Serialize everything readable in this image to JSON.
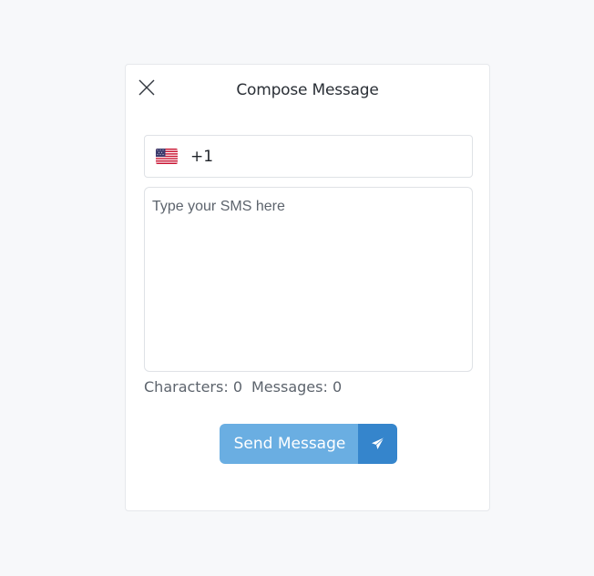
{
  "dialog": {
    "title": "Compose Message",
    "close_icon": "close-icon"
  },
  "phone": {
    "flag_icon": "us-flag-icon",
    "country_code": "+1"
  },
  "message": {
    "placeholder": "Type your SMS here",
    "value": ""
  },
  "counters": {
    "characters_label": "Characters:",
    "characters_value": "0",
    "messages_label": "Messages:",
    "messages_value": "0"
  },
  "send": {
    "label": "Send Message",
    "icon": "paper-plane-icon"
  },
  "colors": {
    "send_primary": "#6aaee2",
    "send_icon_bg": "#3585cc"
  }
}
